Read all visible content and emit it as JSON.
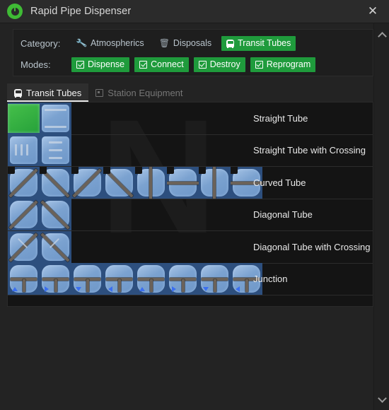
{
  "window": {
    "title": "Rapid Pipe Dispenser",
    "icon": "dispenser-eye-icon",
    "close_label": "✕"
  },
  "options": {
    "category_label": "Category:",
    "categories": [
      {
        "label": "Atmospherics",
        "icon": "wrench-icon",
        "selected": false
      },
      {
        "label": "Disposals",
        "icon": "trash-icon",
        "selected": false
      },
      {
        "label": "Transit Tubes",
        "icon": "tram-icon",
        "selected": true
      }
    ],
    "modes_label": "Modes:",
    "modes": [
      {
        "label": "Dispense",
        "icon": "checkbox-checked-icon",
        "selected": true
      },
      {
        "label": "Connect",
        "icon": "checkbox-checked-icon",
        "selected": true
      },
      {
        "label": "Destroy",
        "icon": "checkbox-checked-icon",
        "selected": true
      },
      {
        "label": "Reprogram",
        "icon": "checkbox-checked-icon",
        "selected": true
      }
    ]
  },
  "tabs": [
    {
      "label": "Transit Tubes",
      "icon": "tram-icon",
      "active": true
    },
    {
      "label": "Station Equipment",
      "icon": "chip-icon",
      "active": false
    }
  ],
  "list": {
    "watermark": "N",
    "rows": [
      {
        "label": "Straight Tube",
        "sprite_count": 2
      },
      {
        "label": "Straight Tube with Crossing",
        "sprite_count": 2
      },
      {
        "label": "Curved Tube",
        "sprite_count": 8
      },
      {
        "label": "Diagonal Tube",
        "sprite_count": 2
      },
      {
        "label": "Diagonal Tube with Crossing",
        "sprite_count": 2
      },
      {
        "label": "Junction",
        "sprite_count": 8
      }
    ]
  },
  "scrollbar": {
    "up_label": "scroll-up",
    "down_label": "scroll-down"
  },
  "colors": {
    "accent_green": "#1f9b3c",
    "titlebar": "#2b2b2b",
    "panel": "#1e1e1e",
    "content": "#141414",
    "tile_blue": "#7ba2d0",
    "tile_bg": "#2d4f7e"
  }
}
